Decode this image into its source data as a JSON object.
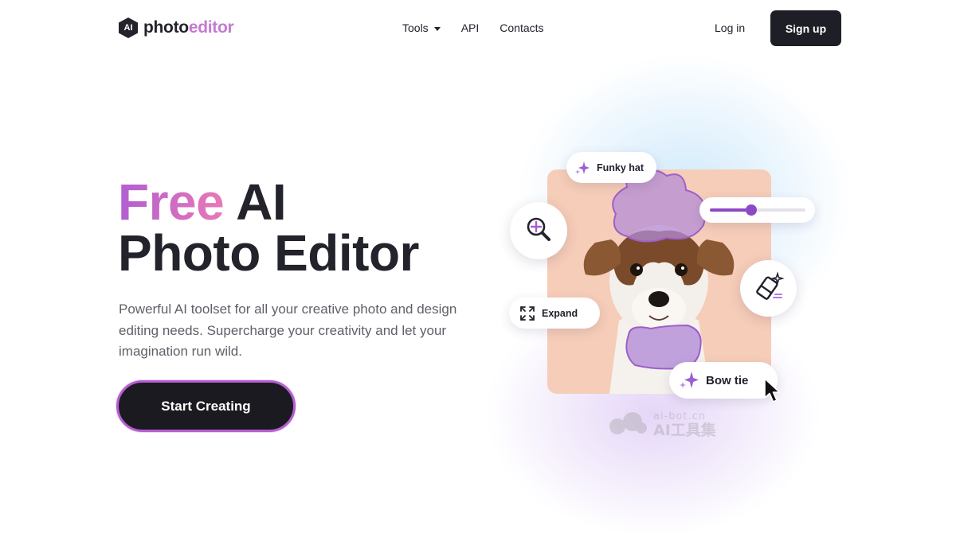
{
  "header": {
    "logo_mark": "AI",
    "logo_part1": "photo",
    "logo_part2": "editor",
    "nav": [
      {
        "label": "Tools",
        "has_dropdown": true
      },
      {
        "label": "API"
      },
      {
        "label": "Contacts"
      }
    ],
    "login_label": "Log in",
    "signup_label": "Sign up"
  },
  "hero": {
    "headline_accent": "Free",
    "headline_line1_rest": " AI",
    "headline_line2": "Photo Editor",
    "subtext": "Powerful AI toolset for all your creative photo and design editing needs. Supercharge your creativity and let your imagination run wild.",
    "cta_label": "Start Creating"
  },
  "illustration": {
    "chip_funky_hat": "Funky hat",
    "chip_expand": "Expand",
    "chip_bow_tie": "Bow tie",
    "slider_value": 0.43,
    "icons": [
      "sparkle-icon",
      "zoom-in-icon",
      "expand-icon",
      "eraser-icon",
      "cursor-icon"
    ]
  },
  "watermark": {
    "small": "ai-bot.cn",
    "big": "AI工具集"
  },
  "colors": {
    "accent_purple": "#8d49c4",
    "gradient_start": "#b15ed2",
    "gradient_end": "#e979b6",
    "dark": "#1e1f26",
    "photo_bg": "#f6cdb8"
  }
}
